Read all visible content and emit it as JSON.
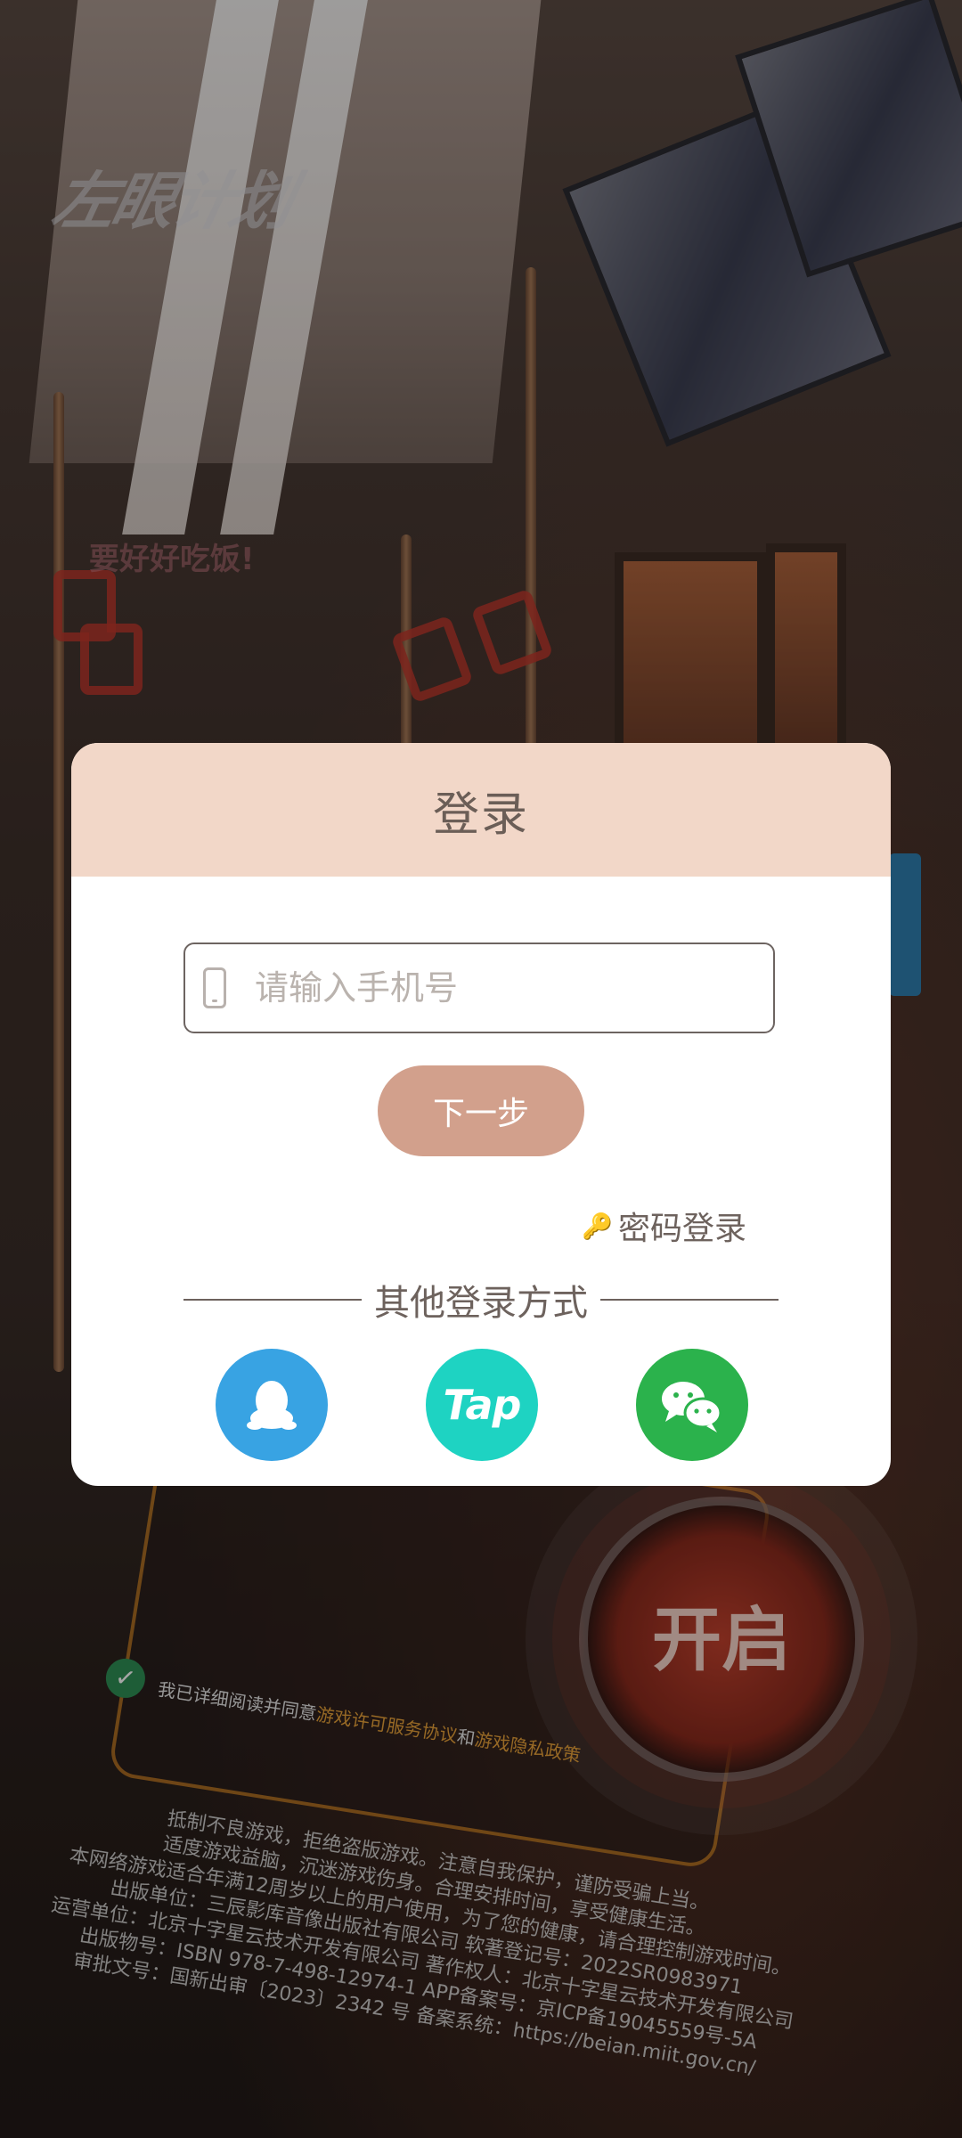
{
  "background": {
    "logo_text": "左眼计划",
    "sign_text": "要好好吃饭!",
    "dial_label": "开启",
    "agreement": {
      "prefix": "我已详细阅读并同意",
      "link1": "游戏许可服务协议",
      "and": "和",
      "link2": "游戏隐私政策"
    },
    "disclaimer_lines": [
      "抵制不良游戏，拒绝盗版游戏。注意自我保护，谨防受骗上当。",
      "适度游戏益脑，沉迷游戏伤身。合理安排时间，享受健康生活。",
      "本网络游戏适合年满12周岁以上的用户使用，为了您的健康，请合理控制游戏时间。",
      "出版单位：三辰影库音像出版社有限公司 软著登记号：2022SR0983971",
      "运营单位：北京十字星云技术开发有限公司 著作权人：北京十字星云技术开发有限公司",
      "出版物号：ISBN 978-7-498-12974-1 APP备案号：京ICP备19045559号-5A",
      "审批文号：国新出审〔2023〕2342 号 备案系统：https://beian.miit.gov.cn/"
    ]
  },
  "login": {
    "title": "登录",
    "phone_placeholder": "请输入手机号",
    "phone_value": "",
    "next_label": "下一步",
    "password_login_label": "密码登录",
    "other_methods_label": "其他登录方式",
    "social": [
      {
        "name": "QQ",
        "icon": "qq-penguin-icon",
        "color": "#38a3e3"
      },
      {
        "name": "Tap",
        "icon": "taptap-icon",
        "color": "#1ed3c2"
      },
      {
        "name": "WeChat",
        "icon": "wechat-icon",
        "color": "#2bb24c"
      }
    ],
    "tap_label": "Tap"
  },
  "colors": {
    "header_bg": "#f2d7c8",
    "next_button": "#d2a08c",
    "text_muted": "#6d625d"
  }
}
